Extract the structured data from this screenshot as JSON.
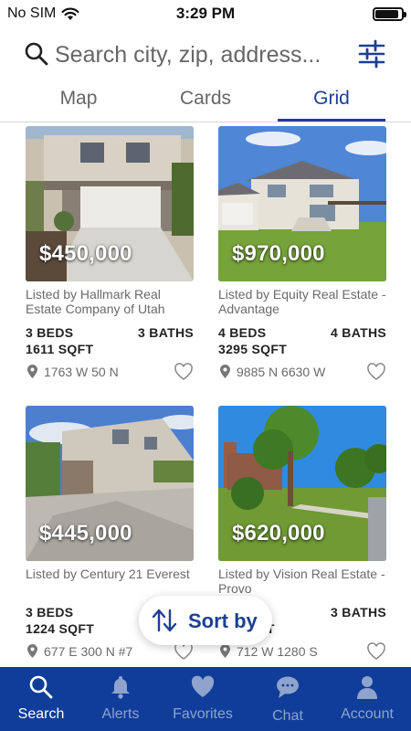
{
  "status_bar": {
    "carrier": "No SIM",
    "time": "3:29 PM",
    "battery_level": 0.9
  },
  "search": {
    "placeholder": "Search city, zip, address..."
  },
  "tabs": [
    {
      "label": "Map",
      "active": false
    },
    {
      "label": "Cards",
      "active": false
    },
    {
      "label": "Grid",
      "active": true
    }
  ],
  "listings": [
    {
      "price": "$450,000",
      "listed_by": "Listed by Hallmark Real Estate Company of Utah",
      "beds": "3 BEDS",
      "baths": "3 BATHS",
      "sqft": "1611 SQFT",
      "address": "1763 W 50 N"
    },
    {
      "price": "$970,000",
      "listed_by": "Listed by Equity Real Estate - Advantage",
      "beds": "4 BEDS",
      "baths": "4 BATHS",
      "sqft": "3295 SQFT",
      "address": "9885 N 6630 W"
    },
    {
      "price": "$445,000",
      "listed_by": "Listed by Century 21 Everest",
      "beds": "3 BEDS",
      "baths": "",
      "sqft": "1224 SQFT",
      "address": "677 E 300 N #7"
    },
    {
      "price": "$620,000",
      "listed_by": "Listed by Vision Real Estate - Provo",
      "beds": "",
      "baths": "3 BATHS",
      "sqft": "FT",
      "address": "712 W 1280 S"
    }
  ],
  "sort": {
    "label": "Sort by"
  },
  "bottom_nav": [
    {
      "label": "Search",
      "icon": "search-icon",
      "active": true
    },
    {
      "label": "Alerts",
      "icon": "bell-icon",
      "active": false
    },
    {
      "label": "Favorites",
      "icon": "heart-icon",
      "active": false
    },
    {
      "label": "Chat",
      "icon": "chat-bubble-icon",
      "active": false
    },
    {
      "label": "Account",
      "icon": "person-icon",
      "active": false
    }
  ],
  "colors": {
    "brand_blue": "#0f3d99",
    "accent_blue": "#1c3f94",
    "nav_inactive": "#8fa3cc"
  }
}
